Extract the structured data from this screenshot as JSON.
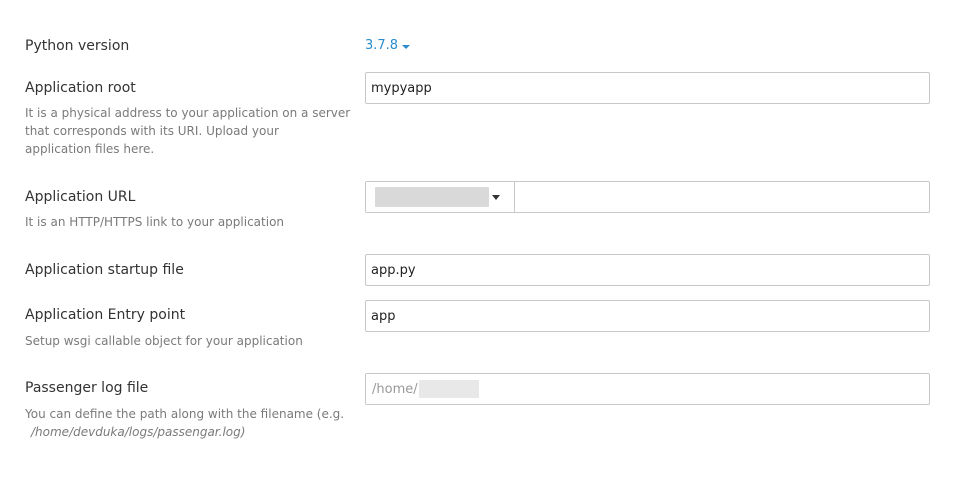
{
  "python_version": {
    "label": "Python version",
    "value": "3.7.8"
  },
  "app_root": {
    "label": "Application root",
    "value": "mypyapp",
    "hint_lines": [
      "It is a physical address to your application on a server",
      "that corresponds with its URI. Upload your",
      "application files here."
    ]
  },
  "app_url": {
    "label": "Application URL",
    "hint": "It is an HTTP/HTTPS link to your application",
    "path_value": ""
  },
  "startup_file": {
    "label": "Application startup file",
    "value": "app.py"
  },
  "entry_point": {
    "label": "Application Entry point",
    "value": "app",
    "hint": "Setup wsgi callable object for your application"
  },
  "passenger_log": {
    "label": "Passenger log file",
    "placeholder": "/home/",
    "hint_line1": "You can define the path along with the filename (e.g.",
    "hint_line2": "/home/devduka/logs/passengar.log)"
  },
  "colors": {
    "link_blue": "#2a8ccf",
    "border": "#c8c8c8",
    "hint_text": "#7a7a7a"
  }
}
